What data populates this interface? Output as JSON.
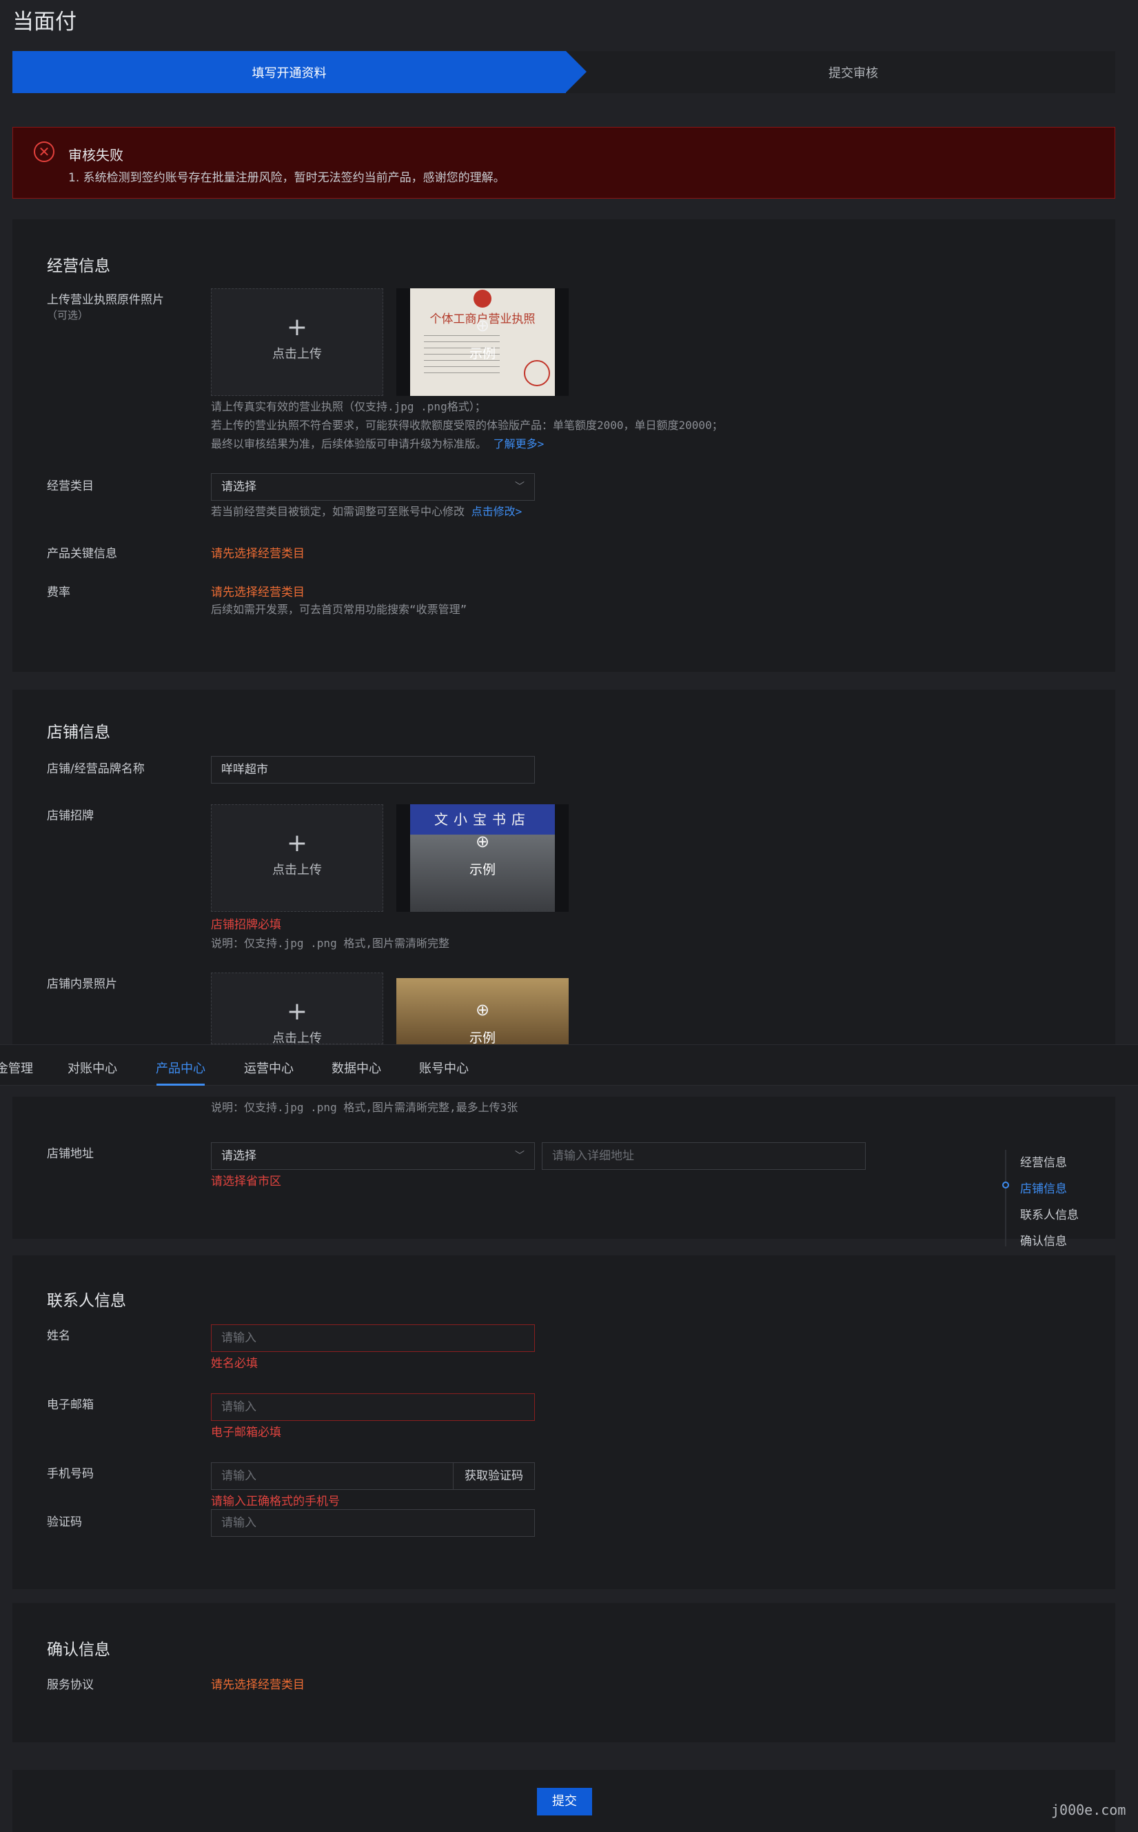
{
  "page": {
    "title": "当面付"
  },
  "steps": {
    "step1": "填写开通资料",
    "step2": "提交审核"
  },
  "alert": {
    "icon": "close-circle-icon",
    "title": "审核失败",
    "message": "1. 系统检测到签约账号存在批量注册风险，暂时无法签约当前产品，感谢您的理解。"
  },
  "business": {
    "title": "经营信息",
    "license_label": "上传营业执照原件照片",
    "license_optional": "（可选）",
    "upload_text": "点击上传",
    "example_text": "示例",
    "license_example_heading": "个体工商户营业执照",
    "license_hint1": "请上传真实有效的营业执照（仅支持.jpg .png格式）；",
    "license_hint2": "若上传的营业执照不符合要求，可能获得收款额度受限的体验版产品：单笔额度2000，单日额度20000；",
    "license_hint3": "最终以审核结果为准，后续体验版可申请升级为标准版。",
    "learn_more": "了解更多>",
    "category_label": "经营类目",
    "category_select": "请选择",
    "category_hint": "若当前经营类目被锁定，如需调整可至账号中心修改",
    "category_modify": "点击修改>",
    "keyinfo_label": "产品关键信息",
    "keyinfo_value": "请先选择经营类目",
    "rate_label": "费率",
    "rate_value": "请先选择经营类目",
    "rate_hint": "后续如需开发票，可去首页常用功能搜索“收票管理”"
  },
  "store": {
    "title": "店铺信息",
    "name_label": "店铺/经营品牌名称",
    "name_value": "咩咩超市",
    "sign_label": "店铺招牌",
    "sign_example_text": "文小宝书店",
    "sign_error": "店铺招牌必填",
    "sign_hint": "说明：仅支持.jpg .png 格式,图片需清晰完整",
    "interior_label": "店铺内景照片",
    "interior_hint": "说明：仅支持.jpg .png 格式,图片需清晰完整,最多上传3张",
    "address_label": "店铺地址",
    "address_select": "请选择",
    "address_detail_placeholder": "请输入详细地址",
    "address_error": "请选择省市区"
  },
  "tabs": [
    {
      "label": "金管理"
    },
    {
      "label": "对账中心"
    },
    {
      "label": "产品中心"
    },
    {
      "label": "运营中心"
    },
    {
      "label": "数据中心"
    },
    {
      "label": "账号中心"
    }
  ],
  "anchor": [
    "经营信息",
    "店铺信息",
    "联系人信息",
    "确认信息"
  ],
  "contact": {
    "title": "联系人信息",
    "name_label": "姓名",
    "name_placeholder": "请输入",
    "name_error": "姓名必填",
    "email_label": "电子邮箱",
    "email_placeholder": "请输入",
    "email_error": "电子邮箱必填",
    "phone_label": "手机号码",
    "phone_placeholder": "请输入",
    "get_code": "获取验证码",
    "phone_error": "请输入正确格式的手机号",
    "code_label": "验证码",
    "code_placeholder": "请输入"
  },
  "confirm": {
    "title": "确认信息",
    "agreement_label": "服务协议",
    "agreement_value": "请先选择经营类目"
  },
  "submit_label": "提交",
  "watermark": "j000e.com",
  "colors": {
    "accent": "#0f5bd6",
    "link": "#3e8df2",
    "error": "#e0443f",
    "warning": "#ee6d34",
    "alert_bg": "#3e0707"
  }
}
